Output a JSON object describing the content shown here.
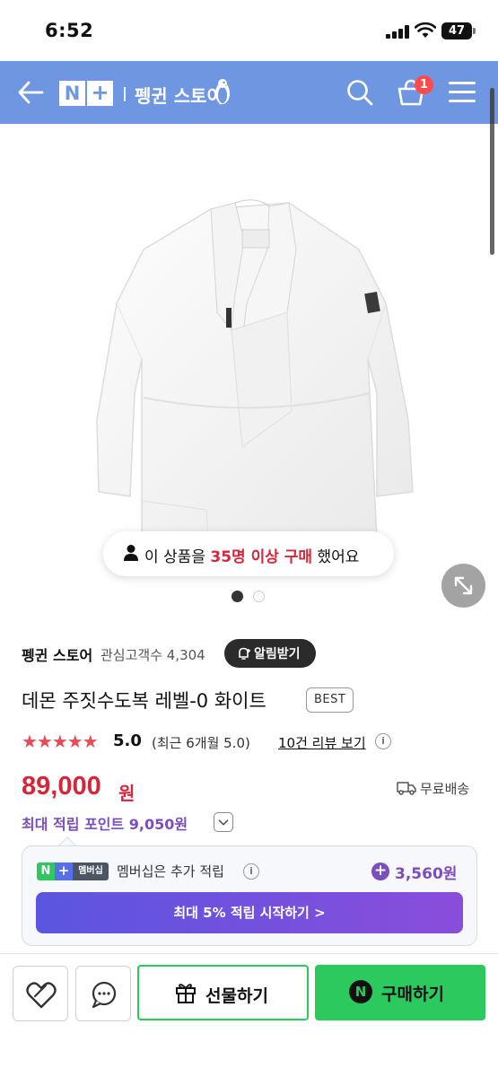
{
  "status_bar": {
    "time": "6:52",
    "battery": "47"
  },
  "header": {
    "logo_n": "N",
    "logo_plus": "+",
    "store_name": "펭귄 스토어",
    "cart_count": "1",
    "bg_color": "#6f96e0"
  },
  "gallery": {
    "purchase_prefix": "이 상품을 ",
    "purchase_count": "35명 이상 구매",
    "purchase_suffix": " 했어요",
    "current_index": 1,
    "total_images": 2
  },
  "seller": {
    "name": "펭귄 스토어",
    "followers": "관심고객수 4,304",
    "alert_label": "알림받기"
  },
  "product": {
    "title": "데몬 주짓수도복 레벨-0 화이트",
    "badge": "BEST",
    "stars": "★★★★★",
    "rating": "5.0",
    "rating_recent": "(최근 6개월 5.0)",
    "review_link": "10건 리뷰 보기",
    "price": "89,000",
    "price_unit": "원",
    "shipping": "무료배송",
    "points": "최대 적립 포인트 9,050원"
  },
  "membership": {
    "logo_n": "N",
    "logo_plus": "+",
    "logo_tag": "멤버십",
    "text": "멤버십은 추가 적립",
    "bonus_points": "3,560원",
    "cta": "최대 5% 적립 시작하기 >"
  },
  "bottom_bar": {
    "gift_label": "선물하기",
    "buy_n": "N",
    "buy_label": "구매하기"
  },
  "colors": {
    "price_red": "#d6263b",
    "points_purple": "#7c4dbf",
    "naver_green": "#2cc95f",
    "star_red": "#e84a56"
  }
}
